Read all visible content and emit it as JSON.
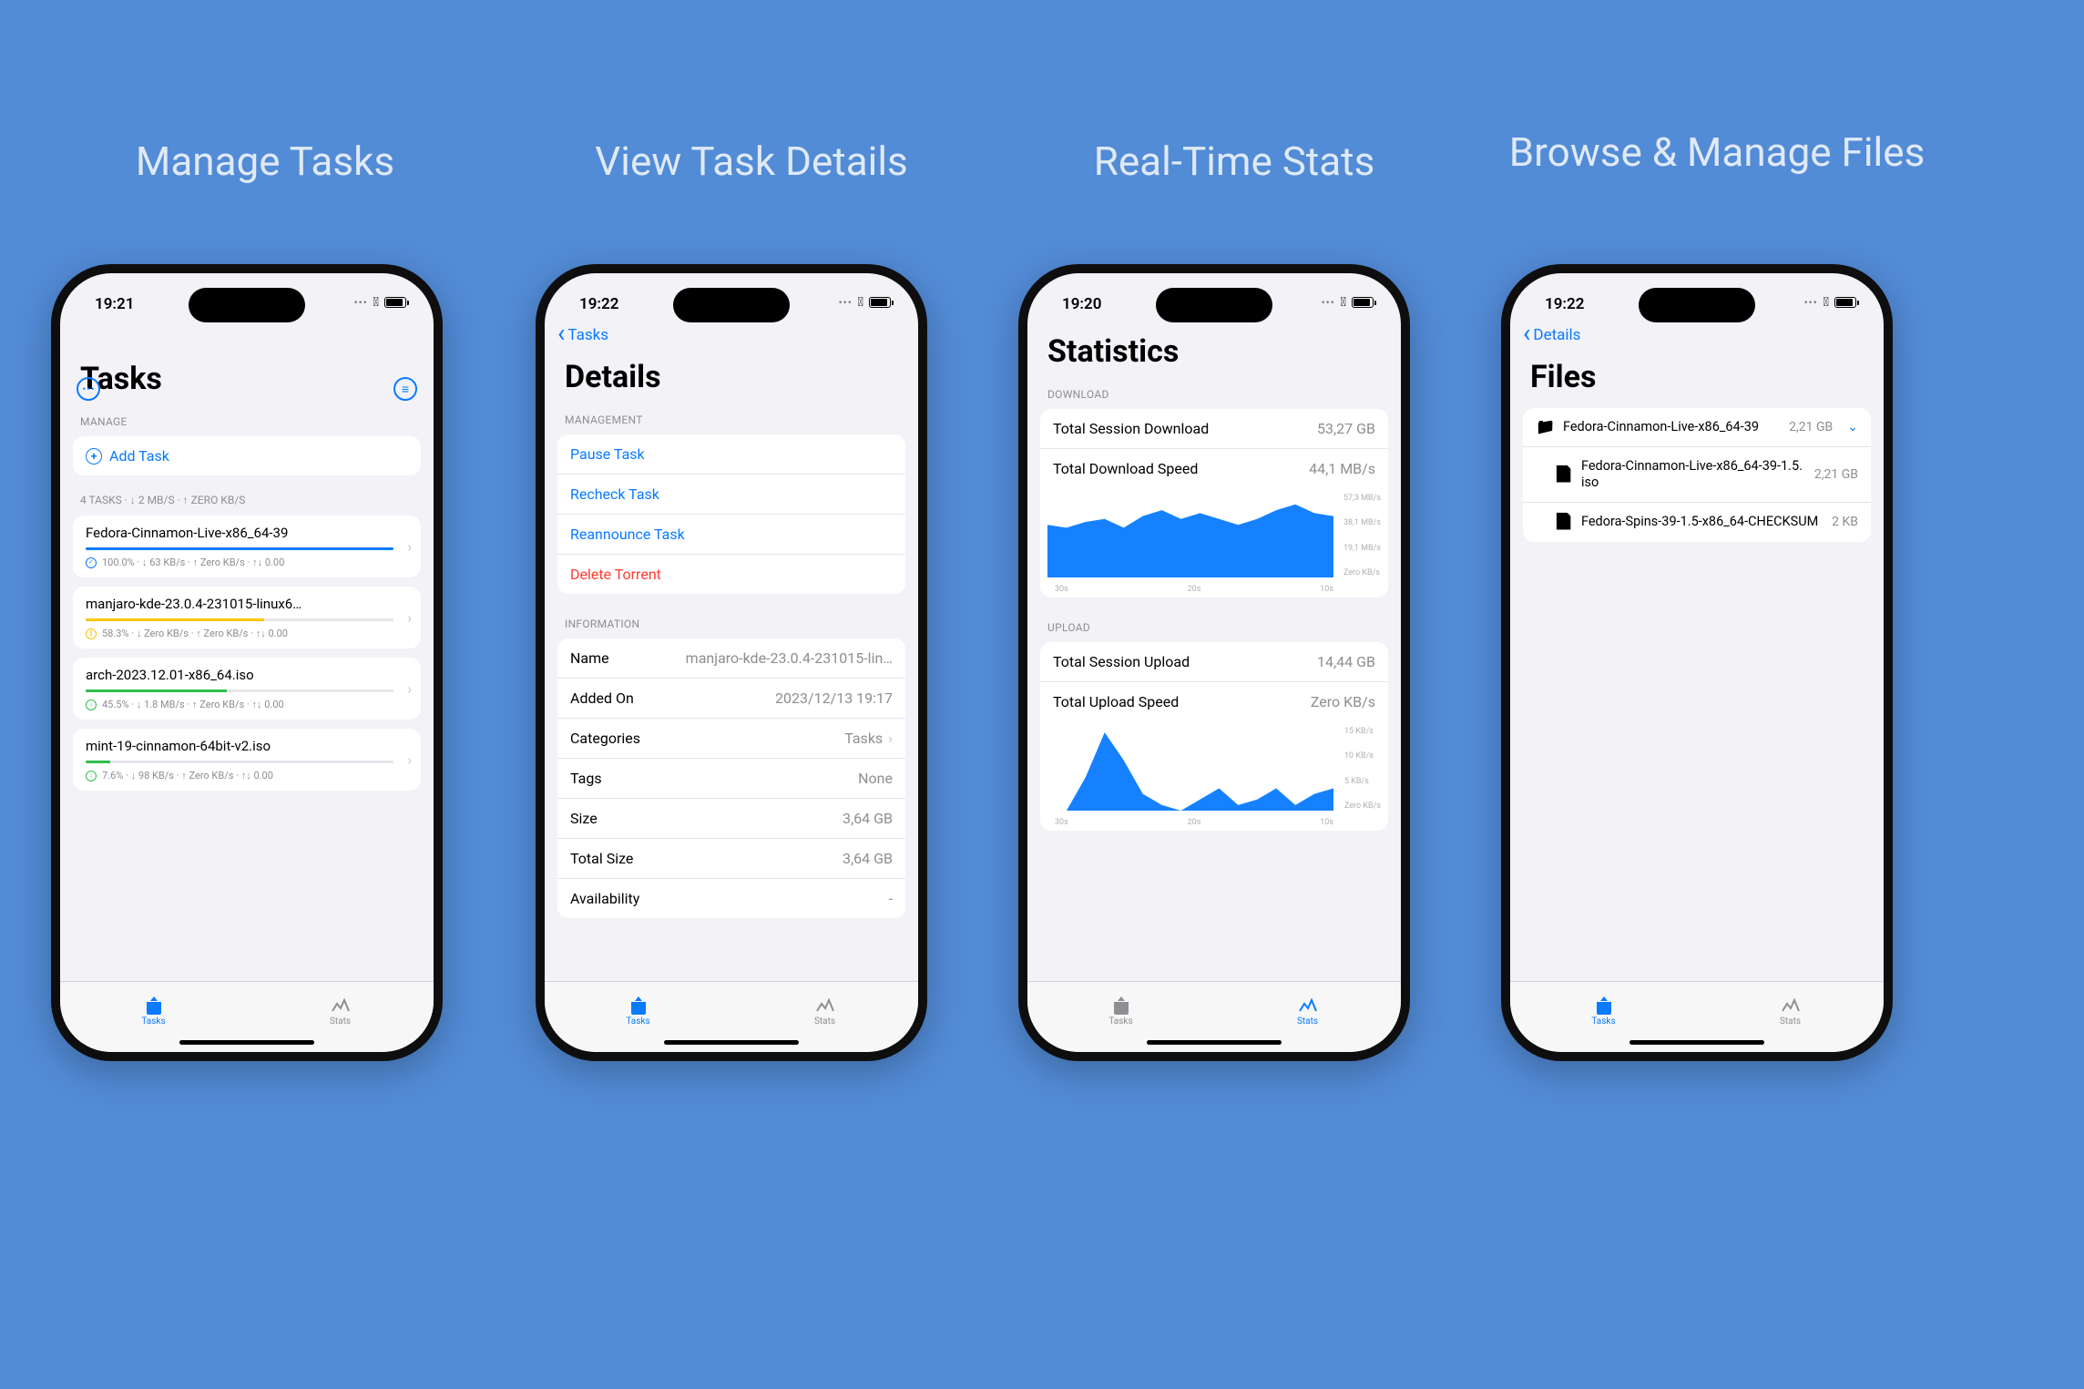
{
  "captions": [
    "Manage Tasks",
    "View Task Details",
    "Real-Time Stats",
    "Browse & Manage Files"
  ],
  "accent": "#0a7aff",
  "tabbar": {
    "tasks": "Tasks",
    "stats": "Stats"
  },
  "phone1": {
    "time": "19:21",
    "title": "Tasks",
    "manage_header": "MANAGE",
    "add_label": "Add Task",
    "list_summary": "4 TASKS · ↓ 2 MB/S · ↑ ZERO KB/S",
    "tasks": [
      {
        "name": "Fedora-Cinnamon-Live-x86_64-39",
        "color": "#0a7aff",
        "pct": 100,
        "icon": "blue",
        "inner": "✓",
        "meta": "100.0% · ↓ 63 KB/s · ↑ Zero KB/s · ↑↓ 0.00"
      },
      {
        "name": "manjaro-kde-23.0.4-231015-linux6…",
        "color": "#ffc500",
        "pct": 58,
        "icon": "yellow",
        "inner": "∥",
        "meta": "58.3% · ↓ Zero KB/s · ↑ Zero KB/s · ↑↓ 0.00"
      },
      {
        "name": "arch-2023.12.01-x86_64.iso",
        "color": "#2fbf4b",
        "pct": 46,
        "icon": "green",
        "inner": "↓",
        "meta": "45.5% · ↓ 1.8 MB/s · ↑ Zero KB/s · ↑↓ 0.00"
      },
      {
        "name": "mint-19-cinnamon-64bit-v2.iso",
        "color": "#2fbf4b",
        "pct": 8,
        "icon": "green",
        "inner": "↓",
        "meta": "7.6% · ↓ 98 KB/s · ↑ Zero KB/s · ↑↓ 0.00"
      }
    ]
  },
  "phone2": {
    "time": "19:22",
    "back": "Tasks",
    "title": "Details",
    "management_header": "MANAGEMENT",
    "actions": [
      {
        "label": "Pause Task",
        "cls": "link"
      },
      {
        "label": "Recheck Task",
        "cls": "link"
      },
      {
        "label": "Reannounce Task",
        "cls": "link"
      },
      {
        "label": "Delete Torrent",
        "cls": "danger"
      }
    ],
    "info_header": "INFORMATION",
    "info": [
      {
        "k": "Name",
        "v": "manjaro-kde-23.0.4-231015-lin…",
        "chev": false
      },
      {
        "k": "Added On",
        "v": "2023/12/13 19:17",
        "chev": false
      },
      {
        "k": "Categories",
        "v": "Tasks",
        "chev": true
      },
      {
        "k": "Tags",
        "v": "None",
        "chev": false
      },
      {
        "k": "Size",
        "v": "3,64 GB",
        "chev": false
      },
      {
        "k": "Total Size",
        "v": "3,64 GB",
        "chev": false
      },
      {
        "k": "Availability",
        "v": "-",
        "chev": false
      }
    ]
  },
  "phone3": {
    "time": "19:20",
    "title": "Statistics",
    "download_header": "DOWNLOAD",
    "download_rows": [
      {
        "k": "Total Session Download",
        "v": "53,27 GB"
      },
      {
        "k": "Total Download Speed",
        "v": "44,1 MB/s"
      }
    ],
    "download_y": [
      "57,3 MB/s",
      "38,1 MB/s",
      "19,1 MB/s",
      "Zero KB/s"
    ],
    "download_x": [
      "30s",
      "20s",
      "10s"
    ],
    "upload_header": "UPLOAD",
    "upload_rows": [
      {
        "k": "Total Session Upload",
        "v": "14,44 GB"
      },
      {
        "k": "Total Upload Speed",
        "v": "Zero KB/s"
      }
    ],
    "upload_y": [
      "15 KB/s",
      "10 KB/s",
      "5 KB/s",
      "Zero KB/s"
    ],
    "upload_x": [
      "30s",
      "20s",
      "10s"
    ]
  },
  "phone4": {
    "time": "19:22",
    "back": "Details",
    "title": "Files",
    "files": [
      {
        "icon": "folder",
        "name": "Fedora-Cinnamon-Live-x86_64-39",
        "size": "2,21 GB",
        "expand": true
      },
      {
        "icon": "file",
        "name": "Fedora-Cinnamon-Live-x86_64-39-1.5.iso",
        "size": "2,21 GB",
        "expand": false,
        "indent": true
      },
      {
        "icon": "file",
        "name": "Fedora-Spins-39-1.5-x86_64-CHECKSUM",
        "size": "2 KB",
        "expand": false,
        "indent": true
      }
    ]
  },
  "chart_data": [
    {
      "type": "area",
      "title": "Total Download Speed",
      "ylabel": "MB/s",
      "ylim": [
        0,
        57.3
      ],
      "x": [
        30,
        28,
        26,
        24,
        22,
        20,
        18,
        16,
        14,
        12,
        10,
        8,
        6,
        4,
        2,
        0
      ],
      "values": [
        36,
        34,
        38,
        40,
        34,
        42,
        46,
        40,
        44,
        40,
        36,
        40,
        46,
        50,
        44,
        42
      ]
    },
    {
      "type": "area",
      "title": "Total Upload Speed",
      "ylabel": "KB/s",
      "ylim": [
        0,
        15
      ],
      "x": [
        30,
        28,
        26,
        24,
        22,
        20,
        18,
        16,
        14,
        12,
        10,
        8,
        6,
        4,
        2,
        0
      ],
      "values": [
        0,
        0,
        6,
        14,
        9,
        3,
        1,
        0,
        2,
        4,
        1,
        2,
        4,
        1,
        3,
        4
      ]
    }
  ]
}
